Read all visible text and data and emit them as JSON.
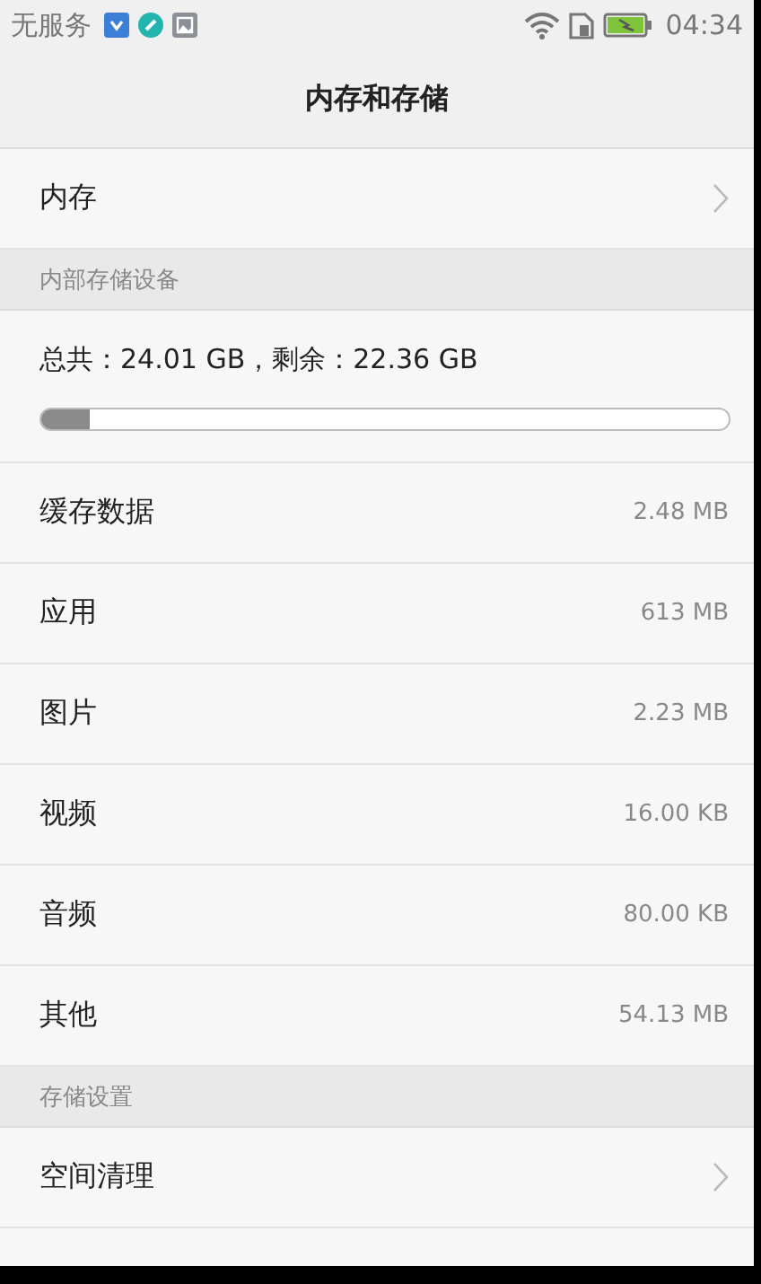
{
  "status_bar": {
    "carrier": "无服务",
    "time": "04:34"
  },
  "title": "内存和存储",
  "top_items": [
    {
      "label": "内存"
    }
  ],
  "sections": [
    {
      "header": "内部存储设备",
      "summary": "总共：24.01 GB，剩余：22.36 GB",
      "usage": {
        "level": 0.07
      },
      "rows": [
        {
          "label": "缓存数据",
          "value": "2.48 MB"
        },
        {
          "label": "应用",
          "value": "613 MB"
        },
        {
          "label": "图片",
          "value": "2.23 MB"
        },
        {
          "label": "视频",
          "value": "16.00 KB"
        },
        {
          "label": "音频",
          "value": "80.00 KB"
        },
        {
          "label": "其他",
          "value": "54.13 MB"
        }
      ]
    },
    {
      "header": "存储设置",
      "links": [
        {
          "label": "空间清理"
        }
      ]
    }
  ]
}
